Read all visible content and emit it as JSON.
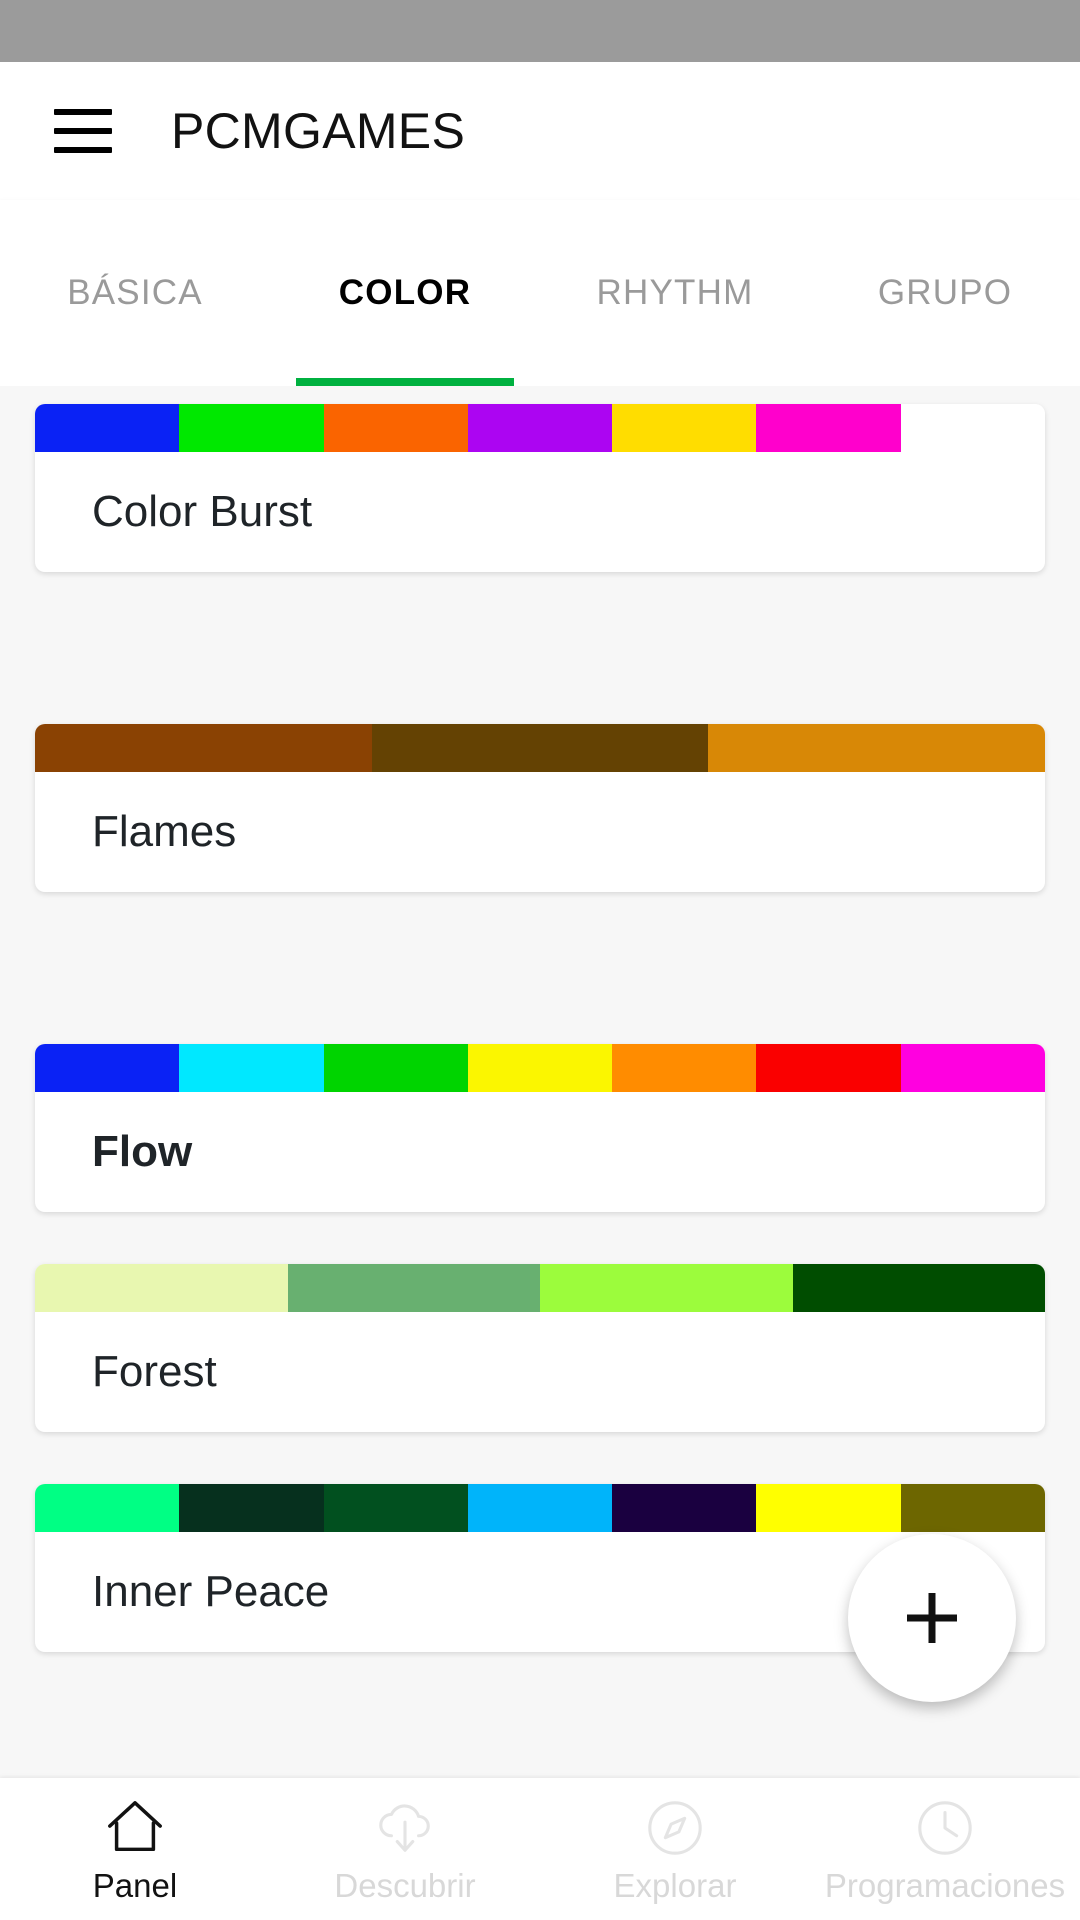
{
  "status_bar": {
    "color": "#9b9b9b"
  },
  "app_bar": {
    "menu_icon": "hamburger-menu-icon",
    "title": "PCMGAMES"
  },
  "tabs": {
    "accent_color": "#00b140",
    "items": [
      {
        "label": "BÁSICA",
        "active": false
      },
      {
        "label": "COLOR",
        "active": true
      },
      {
        "label": "RHYTHM",
        "active": false
      },
      {
        "label": "GRUPO",
        "active": false
      }
    ]
  },
  "effects": [
    {
      "name": "Color Burst",
      "bold": false,
      "colors": [
        "#0a22f5",
        "#00e800",
        "#fa6400",
        "#ac05f2",
        "#ffdd00",
        "#ff00cc",
        "#ffffff"
      ]
    },
    {
      "name": "Flames",
      "bold": false,
      "colors": [
        "#8a4203",
        "#644203",
        "#d88806"
      ]
    },
    {
      "name": "Flow",
      "bold": true,
      "colors": [
        "#0a22f5",
        "#00e8ff",
        "#00d400",
        "#fbf600",
        "#ff8c00",
        "#fa0000",
        "#ff00e0"
      ]
    },
    {
      "name": "Forest",
      "bold": false,
      "colors": [
        "#e8f7b0",
        "#68b070",
        "#9cfc3c",
        "#004d00"
      ]
    },
    {
      "name": "Inner Peace",
      "bold": false,
      "colors": [
        "#00ff84",
        "#06301e",
        "#01501f",
        "#00b4fa",
        "#1a0040",
        "#ffff00",
        "#6d6600"
      ]
    }
  ],
  "fab": {
    "icon": "plus-icon",
    "label": "Add"
  },
  "bottom_nav": {
    "items": [
      {
        "label": "Panel",
        "icon": "home-icon",
        "active": true
      },
      {
        "label": "Descubrir",
        "icon": "cloud-download-icon",
        "active": false
      },
      {
        "label": "Explorar",
        "icon": "compass-icon",
        "active": false
      },
      {
        "label": "Programaciones",
        "icon": "clock-icon",
        "active": false
      }
    ]
  }
}
